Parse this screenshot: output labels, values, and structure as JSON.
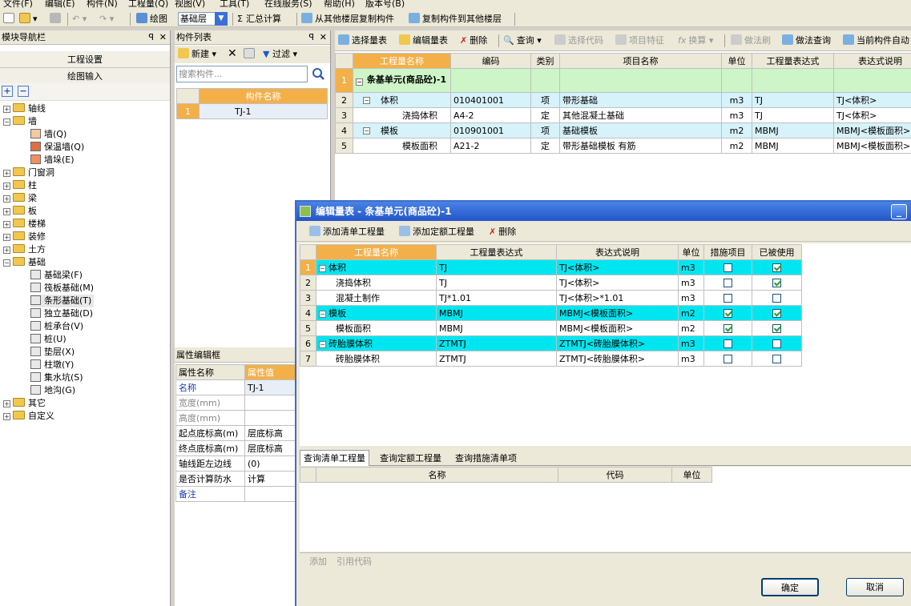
{
  "menubar": {
    "items": [
      "文件(F)",
      "编辑(E)",
      "构件(N)",
      "工程量(Q)",
      "视图(V)",
      "工具(T)",
      "在线服务(S)",
      "帮助(H)",
      "版本号(B)"
    ]
  },
  "toolbar": {
    "draw": "绘图",
    "floor": "基础层",
    "sum": "汇总计算",
    "copy_from": "从其他楼层复制构件",
    "copy_to": "复制构件到其他楼层"
  },
  "left_panel": {
    "title": "模块导航栏",
    "btn_settings": "工程设置",
    "btn_draw_input": "绘图输入",
    "tree": [
      {
        "label": "轴线",
        "level": 0,
        "state": "collapsed"
      },
      {
        "label": "墙",
        "level": 0,
        "state": "expanded"
      },
      {
        "label": "墙(Q)",
        "level": 1
      },
      {
        "label": "保温墙(Q)",
        "level": 1
      },
      {
        "label": "墙垛(E)",
        "level": 1
      },
      {
        "label": "门窗洞",
        "level": 0,
        "state": "collapsed"
      },
      {
        "label": "柱",
        "level": 0,
        "state": "collapsed"
      },
      {
        "label": "梁",
        "level": 0,
        "state": "collapsed"
      },
      {
        "label": "板",
        "level": 0,
        "state": "collapsed"
      },
      {
        "label": "楼梯",
        "level": 0,
        "state": "collapsed"
      },
      {
        "label": "装修",
        "level": 0,
        "state": "collapsed"
      },
      {
        "label": "土方",
        "level": 0,
        "state": "collapsed"
      },
      {
        "label": "基础",
        "level": 0,
        "state": "expanded"
      },
      {
        "label": "基础梁(F)",
        "level": 1
      },
      {
        "label": "筏板基础(M)",
        "level": 1
      },
      {
        "label": "条形基础(T)",
        "level": 1
      },
      {
        "label": "独立基础(D)",
        "level": 1
      },
      {
        "label": "桩承台(V)",
        "level": 1
      },
      {
        "label": "桩(U)",
        "level": 1
      },
      {
        "label": "垫层(X)",
        "level": 1
      },
      {
        "label": "柱墩(Y)",
        "level": 1
      },
      {
        "label": "集水坑(S)",
        "level": 1
      },
      {
        "label": "地沟(G)",
        "level": 1
      },
      {
        "label": "其它",
        "level": 0,
        "state": "collapsed"
      },
      {
        "label": "自定义",
        "level": 0,
        "state": "collapsed"
      }
    ]
  },
  "component_list": {
    "title": "构件列表",
    "new": "新建",
    "filter": "过滤",
    "search_placeholder": "搜索构件...",
    "col_name": "构件名称",
    "rows": [
      {
        "num": "1",
        "name": "TJ-1"
      }
    ]
  },
  "properties": {
    "title": "属性编辑框",
    "col_name": "属性名称",
    "col_value": "属性值",
    "rows": [
      {
        "name": "名称",
        "value": "TJ-1"
      },
      {
        "name": "宽度(mm)",
        "value": ""
      },
      {
        "name": "高度(mm)",
        "value": ""
      },
      {
        "name": "起点底标高(m)",
        "value": "层底标高"
      },
      {
        "name": "终点底标高(m)",
        "value": "层底标高"
      },
      {
        "name": "轴线距左边线",
        "value": "(0)"
      },
      {
        "name": "是否计算防水",
        "value": "计算"
      },
      {
        "name": "备注",
        "value": ""
      }
    ]
  },
  "main_toolbar": {
    "items": [
      "选择量表",
      "编辑量表",
      "删除",
      "查询",
      "选择代码",
      "项目特征",
      "换算",
      "做法刷",
      "做法查询",
      "当前构件自动"
    ]
  },
  "main_table": {
    "headers": [
      "工程量名称",
      "编码",
      "类别",
      "项目名称",
      "单位",
      "工程量表达式",
      "表达式说明"
    ],
    "rows": [
      {
        "num": "1",
        "name": "条基单元(商品砼)-1",
        "code": "",
        "type": "",
        "item": "",
        "unit": "",
        "expr": "",
        "desc": ""
      },
      {
        "num": "2",
        "name": "体积",
        "code": "010401001",
        "type": "项",
        "item": "带形基础",
        "unit": "m3",
        "expr": "TJ",
        "desc": "TJ<体积>"
      },
      {
        "num": "3",
        "name": "浇捣体积",
        "code": "A4-2",
        "type": "定",
        "item": "其他混凝土基础",
        "unit": "m3",
        "expr": "TJ",
        "desc": "TJ<体积>"
      },
      {
        "num": "4",
        "name": "模板",
        "code": "010901001",
        "type": "项",
        "item": "基础模板",
        "unit": "m2",
        "expr": "MBMJ",
        "desc": "MBMJ<模板面积>"
      },
      {
        "num": "5",
        "name": "模板面积",
        "code": "A21-2",
        "type": "定",
        "item": "带形基础模板 有筋",
        "unit": "m2",
        "expr": "MBMJ",
        "desc": "MBMJ<模板面积>"
      }
    ]
  },
  "dialog": {
    "title": "编辑量表 - 条基单元(商品砼)-1",
    "add_list": "添加清单工程量",
    "add_quota": "添加定额工程量",
    "delete": "删除",
    "headers": [
      "工程量名称",
      "工程量表达式",
      "表达式说明",
      "单位",
      "措施项目",
      "已被使用"
    ],
    "rows": [
      {
        "num": "1",
        "name": "体积",
        "expr": "TJ",
        "desc": "TJ<体积>",
        "unit": "m3",
        "measure": false,
        "used": true
      },
      {
        "num": "2",
        "name": "浇捣体积",
        "expr": "TJ",
        "desc": "TJ<体积>",
        "unit": "m3",
        "measure": false,
        "used": true
      },
      {
        "num": "3",
        "name": "混凝土制作",
        "expr": "TJ*1.01",
        "desc": "TJ<体积>*1.01",
        "unit": "m3",
        "measure": false,
        "used": false
      },
      {
        "num": "4",
        "name": "模板",
        "expr": "MBMJ",
        "desc": "MBMJ<模板面积>",
        "unit": "m2",
        "measure": true,
        "used": true
      },
      {
        "num": "5",
        "name": "模板面积",
        "expr": "MBMJ",
        "desc": "MBMJ<模板面积>",
        "unit": "m2",
        "measure": true,
        "used": true
      },
      {
        "num": "6",
        "name": "砖胎膜体积",
        "expr": "ZTMTJ",
        "desc": "ZTMTJ<砖胎膜体积>",
        "unit": "m3",
        "measure": false,
        "used": false
      },
      {
        "num": "7",
        "name": "砖胎膜体积",
        "expr": "ZTMTJ",
        "desc": "ZTMTJ<砖胎膜体积>",
        "unit": "m3",
        "measure": false,
        "used": false
      }
    ],
    "tabs": [
      "查询清单工程量",
      "查询定额工程量",
      "查询措施清单项"
    ],
    "query_headers": [
      "名称",
      "代码",
      "单位"
    ],
    "add": "添加",
    "ref_code": "引用代码",
    "ok": "确定",
    "cancel": "取消"
  },
  "colors": {
    "orange_header": "#f3b049",
    "cyan_row": "#00e6f0",
    "green_row": "#cdf5c8",
    "blue_row": "#d6f2fa"
  }
}
